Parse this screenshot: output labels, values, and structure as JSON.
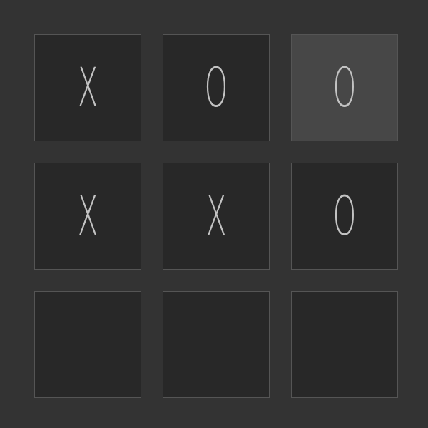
{
  "board": {
    "cells": [
      {
        "mark": "X",
        "highlighted": false
      },
      {
        "mark": "O",
        "highlighted": false
      },
      {
        "mark": "O",
        "highlighted": true
      },
      {
        "mark": "X",
        "highlighted": false
      },
      {
        "mark": "X",
        "highlighted": false
      },
      {
        "mark": "O",
        "highlighted": false
      },
      {
        "mark": "",
        "highlighted": false
      },
      {
        "mark": "",
        "highlighted": false
      },
      {
        "mark": "",
        "highlighted": false
      }
    ]
  },
  "colors": {
    "background": "#333333",
    "cell": "#282828",
    "cell_highlight": "#474747",
    "cell_border": "#555555",
    "mark": "#c3c3c3"
  }
}
